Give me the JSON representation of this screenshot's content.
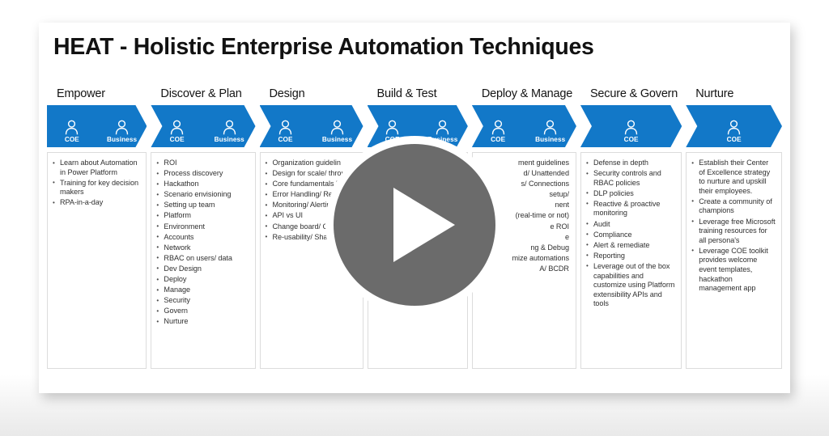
{
  "slide": {
    "title": "HEAT - Holistic Enterprise Automation Techniques",
    "accent_color": "#1278c8",
    "card_background": "#ffffff",
    "page_background": "#fdfdfd"
  },
  "player": {
    "play_button_label": "Play",
    "circle_color": "#6b6b6b",
    "triangle_color": "#ffffff",
    "halo_color": "#ffffff"
  },
  "columns": [
    {
      "header": "Empower",
      "personas": [
        "COE",
        "Business"
      ],
      "items": [
        "Learn about Automation in Power Platform",
        "Training for key decision makers",
        "RPA-in-a-day"
      ]
    },
    {
      "header": "Discover & Plan",
      "personas": [
        "COE",
        "Business"
      ],
      "items": [
        "ROI",
        "Process discovery",
        "Hackathon",
        "Scenario envisioning",
        "Setting up team",
        "Platform",
        "Environment",
        "Accounts",
        "Network",
        "RBAC on users/ data",
        "Dev Design",
        "Deploy",
        "Manage",
        "Security",
        "Govern",
        "Nurture"
      ]
    },
    {
      "header": "Design",
      "personas": [
        "COE",
        "Business"
      ],
      "items": [
        "Organization guidelin",
        "Design for scale/ throughput/ resilier",
        "Core fundamentals logging/ credentia management/ test",
        "Error Handling/ Re",
        "Monitoring/ Alertin",
        "API vs UI",
        "Change board/ Code review",
        "Re-usability/ Share"
      ]
    },
    {
      "header": "Build & Test",
      "personas": [
        "COE",
        "Business"
      ],
      "items": []
    },
    {
      "header": "Deploy & Manage",
      "personas": [
        "COE",
        "Business"
      ],
      "items": [
        "ment guidelines",
        "d/ Unattended",
        "s/ Connections",
        "setup/",
        "nent",
        "(real-time or not)",
        "e ROI",
        "e",
        "ng & Debug",
        "mize automations",
        "A/ BCDR"
      ]
    },
    {
      "header": "Secure & Govern",
      "personas": [
        "COE"
      ],
      "items": [
        "Defense in depth",
        "Security controls and RBAC policies",
        "DLP policies",
        "Reactive & proactive monitoring",
        "Audit",
        "Compliance",
        "Alert & remediate",
        "Reporting",
        "Leverage out of the box capabilities and customize using Platform extensibility APIs and tools"
      ]
    },
    {
      "header": "Nurture",
      "personas": [
        "COE"
      ],
      "items": [
        "Establish their Center of Excellence strategy to nurture and upskill their employees.",
        "Create a community of champions",
        "Leverage free Microsoft training resources for all persona's",
        "Leverage COE toolkit provides welcome event templates, hackathon management app"
      ]
    }
  ]
}
